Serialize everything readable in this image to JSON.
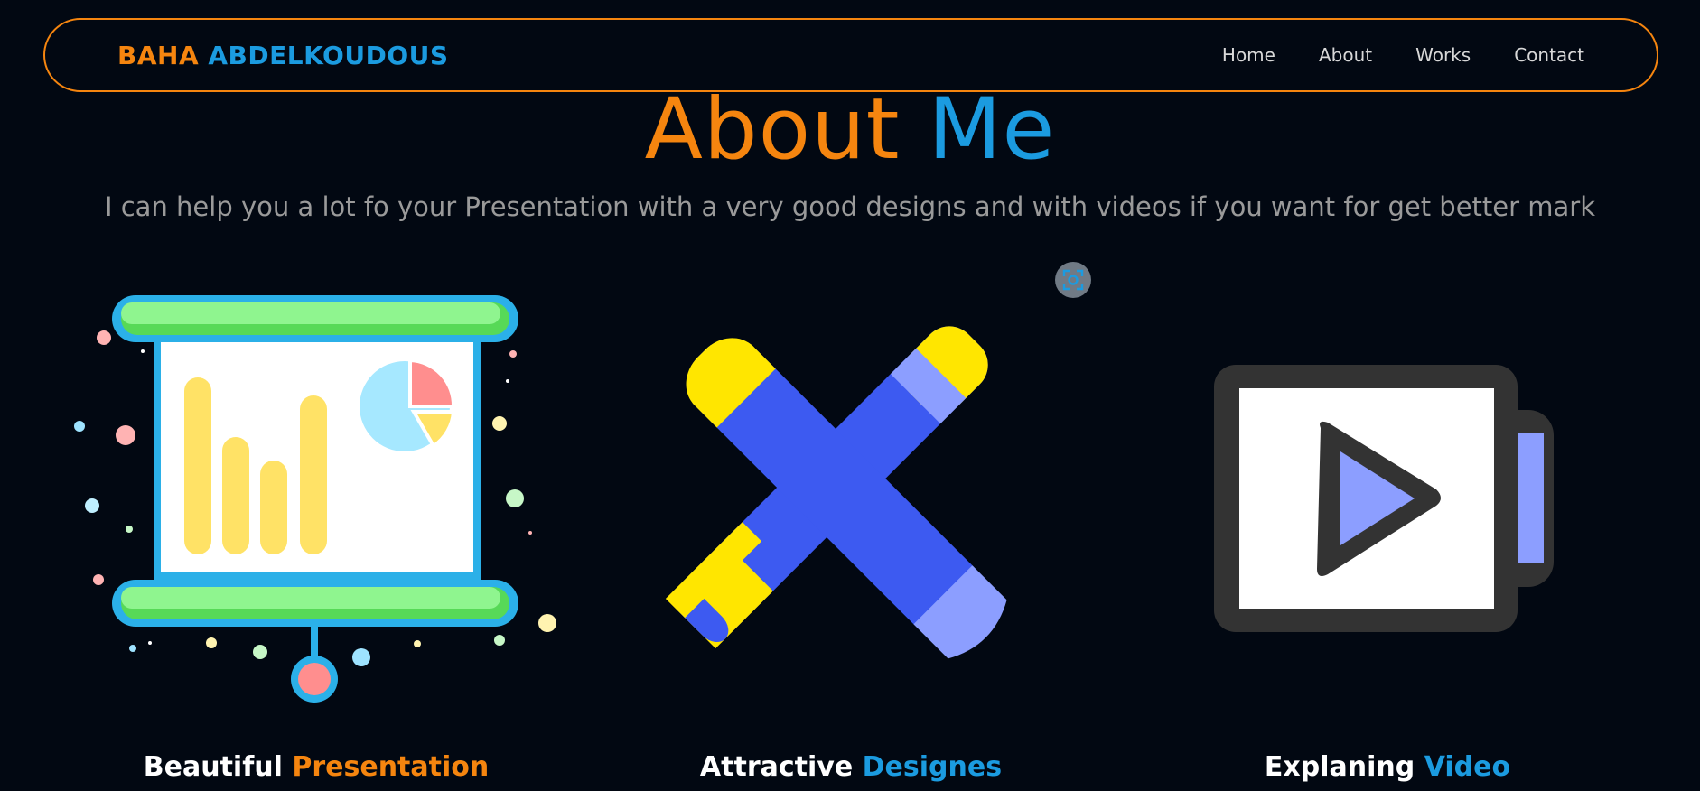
{
  "nav": {
    "brand_first": "BAHA",
    "brand_last": "ABDELKOUDOUS",
    "links": [
      "Home",
      "About",
      "Works",
      "Contact"
    ]
  },
  "about": {
    "title_first": "About",
    "title_last": "Me",
    "tagline": "I can help you a lot fo your Presentation with a very good designs and with videos if you want for get better mark"
  },
  "cards": [
    {
      "icon": "presentation-board-icon",
      "word1": "Beautiful",
      "word2": "Presentation",
      "accent": "#f5850f"
    },
    {
      "icon": "design-tools-icon",
      "word1": "Attractive",
      "word2": "Designes",
      "accent": "#1b9be0"
    },
    {
      "icon": "video-camera-icon",
      "word1": "Explaning",
      "word2": "Video",
      "accent": "#1b9be0"
    }
  ],
  "scan_button": {
    "icon": "screen-capture-icon"
  },
  "colors": {
    "background": "#020812",
    "orange": "#f5850f",
    "blue": "#1b9be0",
    "tagline": "#9a9a9a"
  }
}
